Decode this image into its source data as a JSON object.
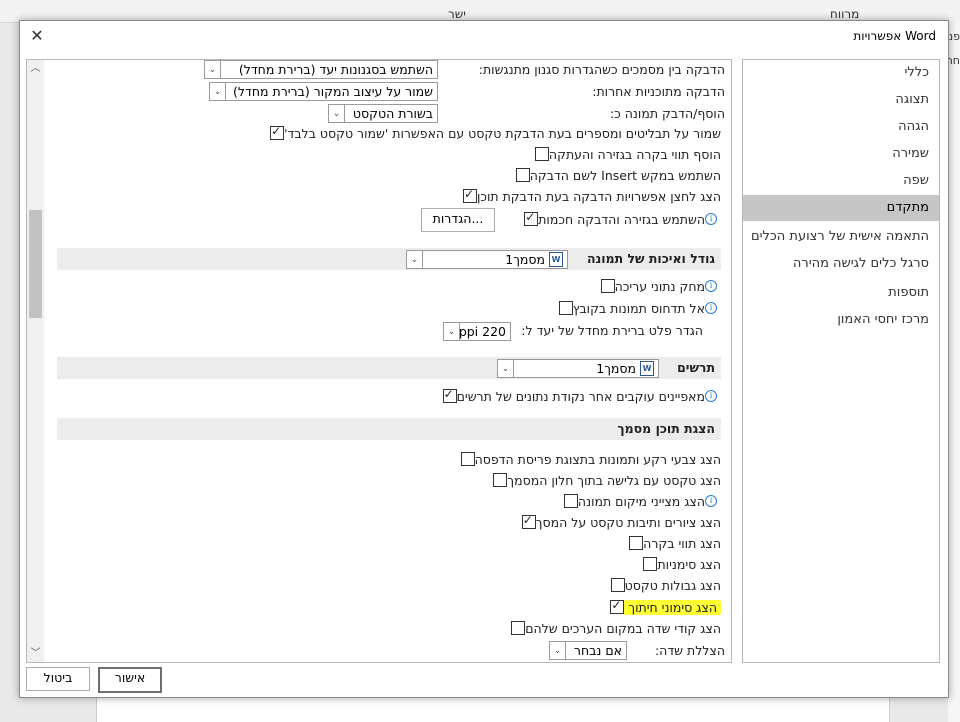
{
  "background": {
    "ribbon_text_1": "מרווח",
    "ribbon_text_2": "ישר",
    "strip_text_1": "פני",
    "strip_text_2": "חרי"
  },
  "dialog": {
    "title": "אפשרויות Word",
    "ok_label": "אישור",
    "cancel_label": "ביטול"
  },
  "nav": {
    "items": [
      {
        "label": "כללי"
      },
      {
        "label": "תצוגה"
      },
      {
        "label": "הגהה"
      },
      {
        "label": "שמירה"
      },
      {
        "label": "שפה"
      },
      {
        "label": "מתקדם"
      },
      {
        "label": "התאמה אישית של רצועת הכלים"
      },
      {
        "label": "סרגל כלים לגישה מהירה"
      },
      {
        "label": "תוספות"
      },
      {
        "label": "מרכז יחסי האמון"
      }
    ],
    "selected_index": 5
  },
  "paste": {
    "between_docs_label": "הדבקה בין מסמכים כשהגדרות סגנון מתנגשות:",
    "between_docs_value": "השתמש בסגנונות יעד (ברירת מחדל)",
    "other_programs_label": "הדבקה מתוכניות אחרות:",
    "other_programs_value": "שמור על עיצוב המקור (ברירת מחדל)",
    "insert_picture_label": "הוסף/הדבק תמונה כ:",
    "insert_picture_value": "בשורת הטקסט",
    "keep_bullets": "שמור על תבליטים ומספרים בעת הדבקת טקסט עם האפשרות 'שמור טקסט בלבד'",
    "add_chars_cut": "הוסף תווי בקרה בגזירה והעתקה",
    "use_insert_key": "השתמש במקש Insert לשם הדבקה",
    "show_paste_options": "הצג לחצן אפשרויות הדבקה בעת הדבקת תוכן",
    "smart_cut": "השתמש בגזירה והדבקה חכמות",
    "settings_button": "הגדרות..."
  },
  "image_size": {
    "header": "גודל ואיכות של תמונה",
    "doc_value": "מסמך1",
    "discard_edit": "מחק נתוני עריכה",
    "no_compress": "אל תדחוס תמונות בקובץ",
    "default_res_label": "הגדר פלט ברירת מחדל של יעד ל:",
    "default_res_value": "220 ppi"
  },
  "charts": {
    "header": "תרשים",
    "doc_value": "מסמך1",
    "properties_follow": "מאפיינים עוקבים אחר נקודת נתונים של תרשים"
  },
  "display": {
    "header": "הצגת תוכן מסמך",
    "bg_colors": "הצג צבעי רקע ותמונות בתצוגת פריסת הדפסה",
    "wrap_text": "הצג טקסט עם גלישה בתוך חלון המסמך",
    "picture_placeholders": "הצג מצייני מיקום תמונה",
    "drawings": "הצג ציורים ותיבות טקסט על המסך",
    "text_animation": "הצג תווי בקרה",
    "bookmarks": "הצג סימניות",
    "text_boundaries": "הצג גבולות טקסט",
    "crop_marks": "הצג סימוני חיתוך",
    "field_codes": "הצג קודי שדה במקום הערכים שלהם",
    "field_shading_label": "הצללת שדה:",
    "field_shading_value": "אם נבחר"
  }
}
